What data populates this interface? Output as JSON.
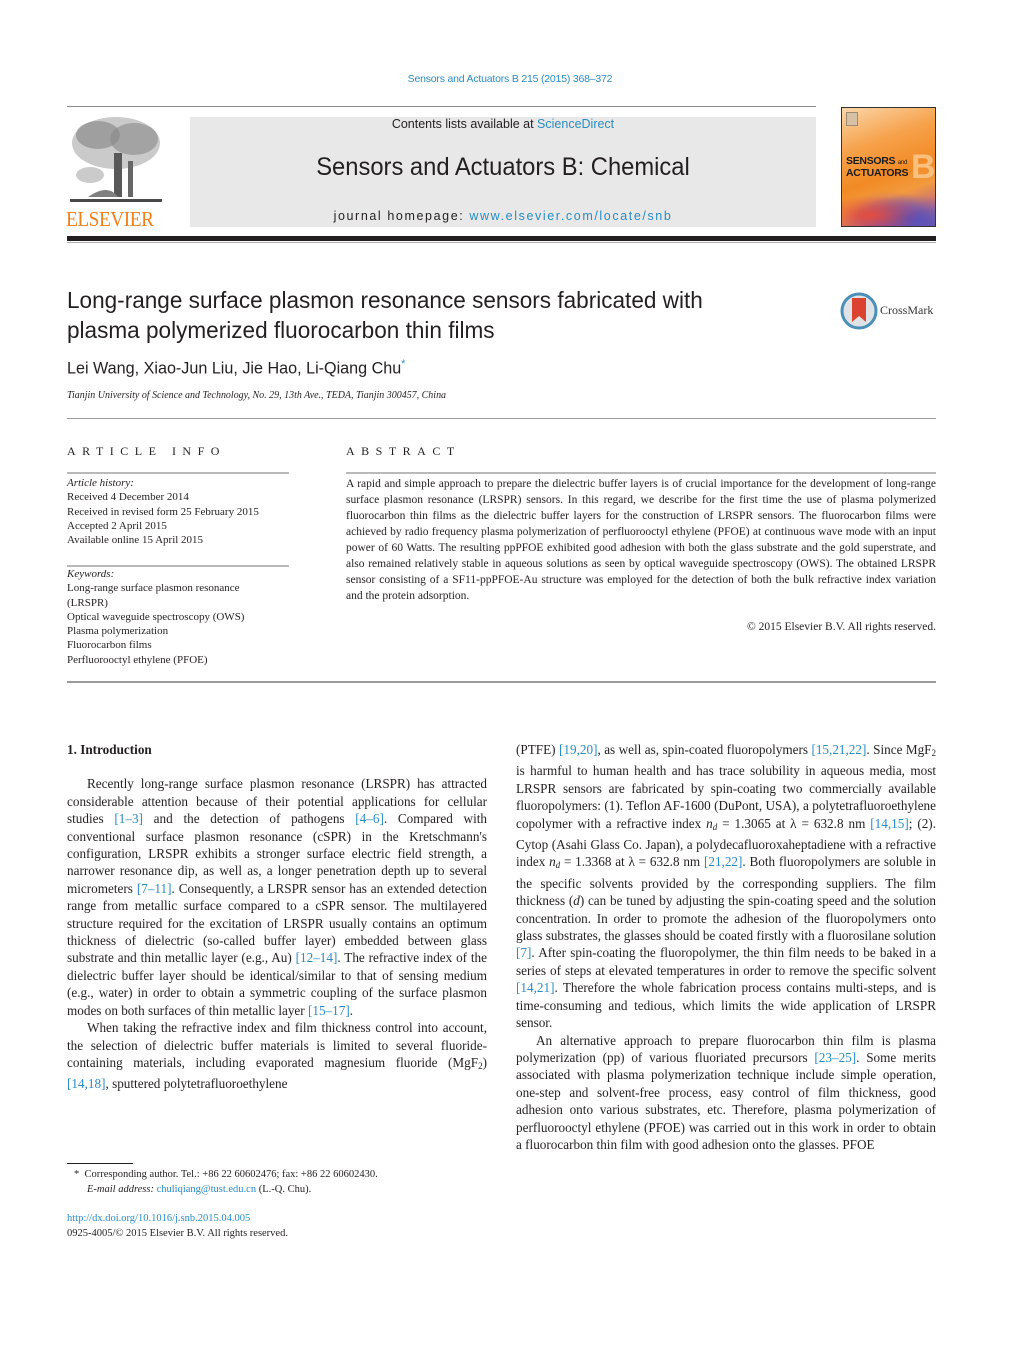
{
  "header": {
    "citation": "Sensors and Actuators B 215 (2015) 368–372",
    "contents_prefix": "Contents lists available at ",
    "contents_link": "ScienceDirect",
    "journal_title": "Sensors and Actuators B: Chemical",
    "homepage_prefix": "journal homepage: ",
    "homepage_link": "www.elsevier.com/locate/snb",
    "publisher_logo_text": "ELSEVIER",
    "cover": {
      "line1": "SENSORS",
      "line1_small": "and",
      "line2": "ACTUATORS",
      "letter": "B"
    },
    "brand_colors": {
      "elsevier_orange": "#f07f1c",
      "link_blue": "#2a8cc2",
      "masthead_gray": "#e8e8e9"
    }
  },
  "article": {
    "title": "Long-range surface plasmon resonance sensors fabricated with plasma polymerized fluorocarbon thin films",
    "authors": "Lei Wang, Xiao-Jun Liu, Jie Hao, Li-Qiang Chu",
    "corresponding_mark": "*",
    "affiliation": "Tianjin University of Science and Technology, No. 29, 13th Ave., TEDA, Tianjin 300457, China",
    "crossmark_label": "CrossMark"
  },
  "article_info": {
    "heading": "ARTICLE INFO",
    "history_label": "Article history:",
    "history": [
      "Received 4 December 2014",
      "Received in revised form 25 February 2015",
      "Accepted 2 April 2015",
      "Available online 15 April 2015"
    ],
    "keywords_label": "Keywords:",
    "keywords": [
      "Long-range surface plasmon resonance (LRSPR)",
      "Optical waveguide spectroscopy (OWS)",
      "Plasma polymerization",
      "Fluorocarbon films",
      "Perfluorooctyl ethylene (PFOE)"
    ]
  },
  "abstract": {
    "heading": "ABSTRACT",
    "text": "A rapid and simple approach to prepare the dielectric buffer layers is of crucial importance for the development of long-range surface plasmon resonance (LRSPR) sensors. In this regard, we describe for the first time the use of plasma polymerized fluorocarbon thin films as the dielectric buffer layers for the construction of LRSPR sensors. The fluorocarbon films were achieved by radio frequency plasma polymerization of perfluorooctyl ethylene (PFOE) at continuous wave mode with an input power of 60 Watts. The resulting ppPFOE exhibited good adhesion with both the glass substrate and the gold superstrate, and also remained relatively stable in aqueous solutions as seen by optical waveguide spectroscopy (OWS). The obtained LRSPR sensor consisting of a SF11-ppPFOE-Au structure was employed for the detection of both the bulk refractive index variation and the protein adsorption.",
    "copyright": "© 2015 Elsevier B.V. All rights reserved."
  },
  "body": {
    "section_title": "1.  Introduction",
    "left": {
      "p1": [
        {
          "t": "Recently long-range surface plasmon resonance (LRSPR) has attracted considerable attention because of their potential applications for cellular studies "
        },
        {
          "ref": "[1–3]"
        },
        {
          "t": " and the detection of pathogens "
        },
        {
          "ref": "[4–6]"
        },
        {
          "t": ". Compared with conventional surface plasmon resonance (cSPR) in the Kretschmann's configuration, LRSPR exhibits a stronger surface electric field strength, a narrower resonance dip, as well as, a longer penetration depth up to several micrometers "
        },
        {
          "ref": "[7–11]"
        },
        {
          "t": ". Consequently, a LRSPR sensor has an extended detection range from metallic surface compared to a cSPR sensor. The multilayered structure required for the excitation of LRSPR usually contains an optimum thickness of dielectric (so-called buffer layer) embedded between glass substrate and thin metallic layer (e.g., Au) "
        },
        {
          "ref": "[12–14]"
        },
        {
          "t": ". The refractive index of the dielectric buffer layer should be identical/similar to that of sensing medium (e.g., water) in order to obtain a symmetric coupling of the surface plasmon modes on both surfaces of thin metallic layer "
        },
        {
          "ref": "[15–17]"
        },
        {
          "t": "."
        }
      ],
      "p2": [
        {
          "t": "When taking the refractive index and film thickness control into account, the selection of dielectric buffer materials is limited to several fluoride-containing materials, including evaporated magnesium fluoride (MgF"
        },
        {
          "sub": "2"
        },
        {
          "t": ") "
        },
        {
          "ref": "[14,18]"
        },
        {
          "t": ", sputtered polytetrafluoroethylene"
        }
      ]
    },
    "right": {
      "p1": [
        {
          "t": "(PTFE) "
        },
        {
          "ref": "[19,20]"
        },
        {
          "t": ", as well as, spin-coated fluoropolymers "
        },
        {
          "ref": "[15,21,22]"
        },
        {
          "t": ". Since MgF"
        },
        {
          "sub": "2"
        },
        {
          "t": " is harmful to human health and has trace solubility in aqueous media, most LRSPR sensors are fabricated by spin-coating two commercially available fluoropolymers: (1). Teflon AF-1600 (DuPont, USA), a polytetrafluoroethylene copolymer with a refractive index "
        },
        {
          "i": "n"
        },
        {
          "sub_i": "d"
        },
        {
          "t": " = 1.3065 at λ = 632.8 nm "
        },
        {
          "ref": "[14,15]"
        },
        {
          "t": "; (2). Cytop (Asahi Glass Co. Japan), a polydecafluoroxaheptadiene with a refractive index "
        },
        {
          "i": "n"
        },
        {
          "sub_i": "d"
        },
        {
          "t": " = 1.3368 at λ = 632.8 nm "
        },
        {
          "ref": "[21,22]"
        },
        {
          "t": ". Both fluoropolymers are soluble in the specific solvents provided by the corresponding suppliers. The film thickness ("
        },
        {
          "i": "d"
        },
        {
          "t": ") can be tuned by adjusting the spin-coating speed and the solution concentration. In order to promote the adhesion of the fluoropolymers onto glass substrates, the glasses should be coated firstly with a fluorosilane solution "
        },
        {
          "ref": "[7]"
        },
        {
          "t": ". After spin-coating the fluoropolymer, the thin film needs to be baked in a series of steps at elevated temperatures in order to remove the specific solvent "
        },
        {
          "ref": "[14,21]"
        },
        {
          "t": ". Therefore the whole fabrication process contains multi-steps, and is time-consuming and tedious, which limits the wide application of LRSPR sensor."
        }
      ],
      "p2": [
        {
          "t": "An alternative approach to prepare fluorocarbon thin film is plasma polymerization (pp) of various fluoriated precursors "
        },
        {
          "ref": "[23–25]"
        },
        {
          "t": ". Some merits associated with plasma polymerization technique include simple operation, one-step and solvent-free process, easy control of film thickness, good adhesion onto various substrates, etc. Therefore, plasma polymerization of perfluorooctyl ethylene (PFOE) was carried out in this work in order to obtain a fluorocarbon thin film with good adhesion onto the glasses. PFOE"
        }
      ]
    }
  },
  "footer": {
    "footnote_mark": "*",
    "corresponding": "Corresponding author. Tel.: +86 22 60602476; fax: +86 22 60602430.",
    "email_label": "E-mail address:",
    "email": "chuliqiang@tust.edu.cn",
    "email_suffix": " (L.-Q. Chu).",
    "doi": "http://dx.doi.org/10.1016/j.snb.2015.04.005",
    "issn_line": "0925-4005/© 2015 Elsevier B.V. All rights reserved."
  }
}
